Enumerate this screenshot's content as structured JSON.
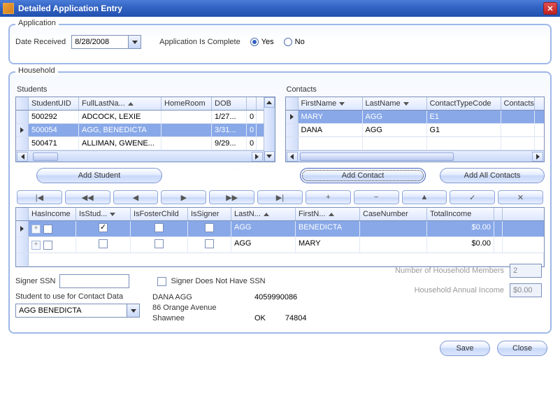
{
  "window": {
    "title": "Detailed Application Entry"
  },
  "application": {
    "groupTitle": "Application",
    "dateLabel": "Date Received",
    "dateValue": "8/28/2008",
    "completeLabel": "Application Is Complete",
    "yesLabel": "Yes",
    "noLabel": "No",
    "completeValue": "Yes"
  },
  "household": {
    "groupTitle": "Household",
    "studentsTitle": "Students",
    "contactsTitle": "Contacts",
    "studentCols": {
      "uid": "StudentUID",
      "name": "FullLastNa...",
      "homeroom": "HomeRoom",
      "dob": "DOB"
    },
    "students": [
      {
        "uid": "500292",
        "name": "ADCOCK, LEXIE",
        "homeroom": "",
        "dob": "1/27...",
        "x": "0"
      },
      {
        "uid": "500054",
        "name": "AGG, BENEDICTA",
        "homeroom": "",
        "dob": "3/31...",
        "x": "0"
      },
      {
        "uid": "500471",
        "name": "ALLIMAN, GWENE...",
        "homeroom": "",
        "dob": "9/29...",
        "x": "0"
      }
    ],
    "studentSelectedIndex": 1,
    "contactCols": {
      "first": "FirstName",
      "last": "LastName",
      "type": "ContactTypeCode",
      "extra": "Contacts"
    },
    "contacts": [
      {
        "first": "MARY",
        "last": "AGG",
        "type": "E1"
      },
      {
        "first": "DANA",
        "last": "AGG",
        "type": "G1"
      }
    ],
    "contactSelectedIndex": 0,
    "addStudent": "Add Student",
    "addContact": "Add Contact",
    "addAll": "Add All Contacts",
    "memberCols": {
      "hasIncome": "HasIncome",
      "isStud": "IsStud...",
      "isFoster": "IsFosterChild",
      "isSigner": "IsSigner",
      "lastN": "LastN...",
      "firstN": "FirstN...",
      "caseNum": "CaseNumber",
      "totalIncome": "TotalIncome"
    },
    "members": [
      {
        "hasIncome": false,
        "isStud": true,
        "isFoster": false,
        "isSigner": false,
        "last": "AGG",
        "first": "BENEDICTA",
        "caseNum": "",
        "income": "$0.00"
      },
      {
        "hasIncome": false,
        "isStud": false,
        "isFoster": false,
        "isSigner": false,
        "last": "AGG",
        "first": "MARY",
        "caseNum": "",
        "income": "$0.00"
      }
    ],
    "memberSelectedIndex": 0
  },
  "signer": {
    "ssnLabel": "Signer SSN",
    "ssnValue": "",
    "noSsnLabel": "Signer Does Not Have SSN",
    "noSsnChecked": false,
    "studentForContactLabel": "Student to use for Contact Data",
    "studentForContactValue": "AGG BENEDICTA",
    "contactName": "DANA AGG",
    "contactStreet": "86 Orange Avenue",
    "contactCity": "Shawnee",
    "contactPhone": "4059990086",
    "contactState": "OK",
    "contactZip": "74804",
    "numMembersLabel": "Number of Household Members",
    "numMembersValue": "2",
    "annualIncomeLabel": "Household Annual Income",
    "annualIncomeValue": "$0.00"
  },
  "buttons": {
    "save": "Save",
    "close": "Close"
  },
  "nav": {
    "first": "|◀",
    "prevPage": "◀◀",
    "prev": "◀",
    "next": "▶",
    "nextPage": "▶▶",
    "last": "▶|",
    "add": "+",
    "del": "−",
    "up": "▲",
    "ok": "✓",
    "cancel": "✕"
  }
}
